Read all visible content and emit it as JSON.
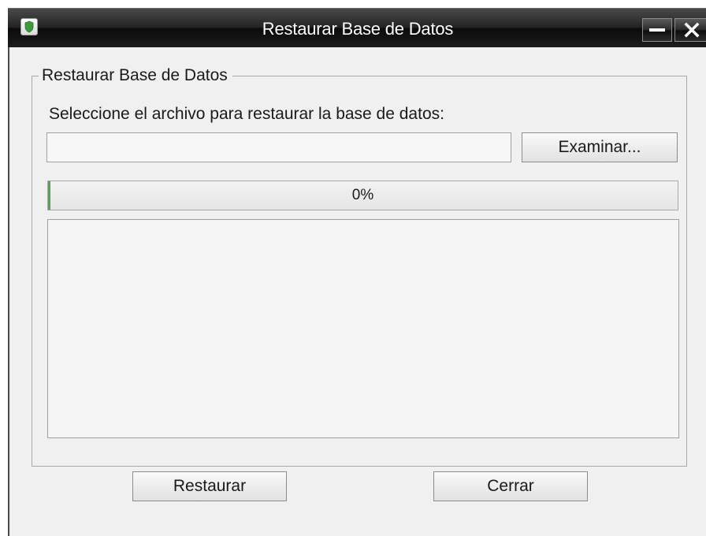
{
  "window": {
    "title": "Restaurar Base de Datos",
    "icon": "shield-app-icon",
    "minimize_icon": "minimize-icon",
    "close_icon": "close-icon"
  },
  "group": {
    "legend": "Restaurar Base de Datos",
    "instruction": "Seleccione el archivo para restaurar la base de datos:"
  },
  "file_input": {
    "value": "",
    "placeholder": ""
  },
  "browse_button": "Examinar...",
  "progress": {
    "value": 0,
    "label": "0%"
  },
  "log": {
    "value": ""
  },
  "buttons": {
    "restore": "Restaurar",
    "close": "Cerrar"
  },
  "colors": {
    "titlebar": "#1c1c1c",
    "window_bg": "#f0f0f0",
    "progress_fill": "#4fa84f",
    "icon_green": "#3c9a3c"
  }
}
